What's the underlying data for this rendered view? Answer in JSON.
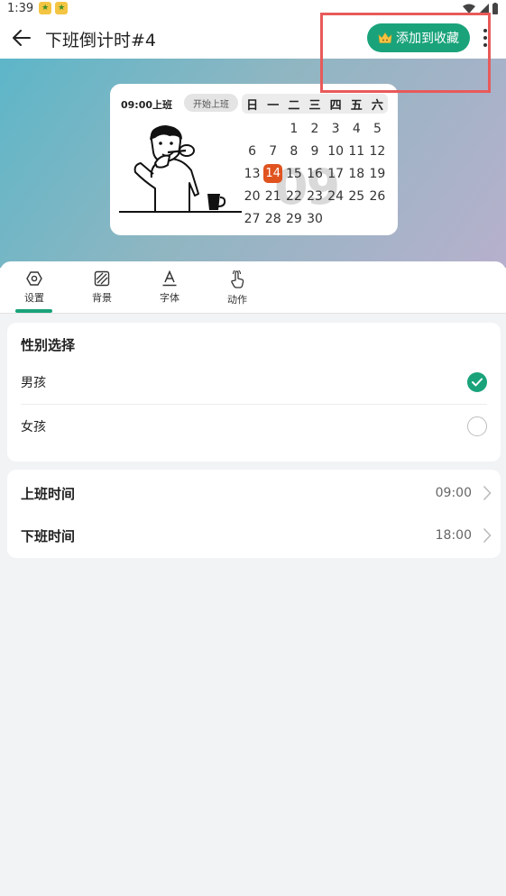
{
  "status_bar": {
    "time": "1:39"
  },
  "header": {
    "title": "下班倒计时#4",
    "favorite_label": "添加到收藏"
  },
  "widget": {
    "work_time_label": "09:00上班",
    "start_work_label": "开始上班",
    "calendar": {
      "weekdays": [
        "日",
        "一",
        "二",
        "三",
        "四",
        "五",
        "六"
      ],
      "days": [
        "",
        "",
        "1",
        "2",
        "3",
        "4",
        "5",
        "6",
        "7",
        "8",
        "9",
        "10",
        "11",
        "12",
        "13",
        "14",
        "15",
        "16",
        "17",
        "18",
        "19",
        "20",
        "21",
        "22",
        "23",
        "24",
        "25",
        "26",
        "27",
        "28",
        "29",
        "30"
      ],
      "today": "14",
      "big_label": "09"
    }
  },
  "tabs": [
    {
      "label": "设置",
      "icon": "hexagon-settings-icon"
    },
    {
      "label": "背景",
      "icon": "background-icon"
    },
    {
      "label": "字体",
      "icon": "font-icon"
    },
    {
      "label": "动作",
      "icon": "hand-pointer-icon"
    }
  ],
  "gender": {
    "title": "性别选择",
    "options": [
      {
        "label": "男孩",
        "selected": true
      },
      {
        "label": "女孩",
        "selected": false
      }
    ]
  },
  "times": {
    "on_work": {
      "label": "上班时间",
      "value": "09:00"
    },
    "off_work": {
      "label": "下班时间",
      "value": "18:00"
    }
  },
  "colors": {
    "accent": "#1aa37a",
    "today": "#e0531f",
    "highlight": "#e85a5a"
  }
}
